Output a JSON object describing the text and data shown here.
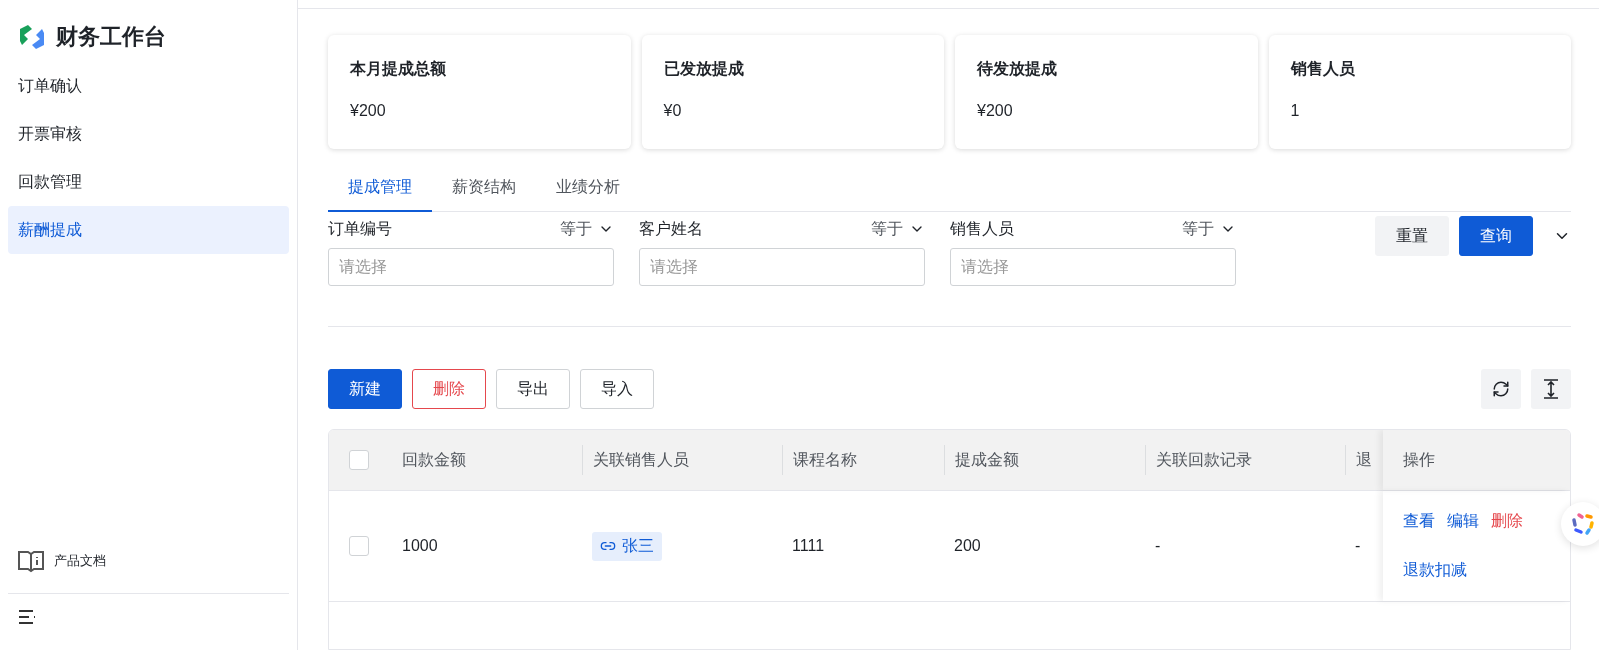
{
  "sidebar": {
    "title": "财务工作台",
    "items": [
      {
        "label": "订单确认",
        "selected": false
      },
      {
        "label": "开票审核",
        "selected": false
      },
      {
        "label": "回款管理",
        "selected": false
      },
      {
        "label": "薪酬提成",
        "selected": true
      }
    ],
    "footer_link": "产品文档"
  },
  "stats": [
    {
      "label": "本月提成总额",
      "value": "¥200"
    },
    {
      "label": "已发放提成",
      "value": "¥0"
    },
    {
      "label": "待发放提成",
      "value": "¥200"
    },
    {
      "label": "销售人员",
      "value": "1"
    }
  ],
  "tabs": [
    {
      "label": "提成管理",
      "selected": true
    },
    {
      "label": "薪资结构",
      "selected": false
    },
    {
      "label": "业绩分析",
      "selected": false
    }
  ],
  "filters": [
    {
      "label": "订单编号",
      "operator": "等于",
      "placeholder": "请选择"
    },
    {
      "label": "客户姓名",
      "operator": "等于",
      "placeholder": "请选择"
    },
    {
      "label": "销售人员",
      "operator": "等于",
      "placeholder": "请选择"
    }
  ],
  "filter_buttons": [
    {
      "label": "重置",
      "kind": "default"
    },
    {
      "label": "查询",
      "kind": "primary"
    }
  ],
  "toolbar": [
    {
      "label": "新建",
      "kind": "primary"
    },
    {
      "label": "删除",
      "kind": "danger"
    },
    {
      "label": "导出",
      "kind": "default"
    },
    {
      "label": "导入",
      "kind": "default"
    }
  ],
  "table": {
    "header_checked": false,
    "columns": [
      "回款金额",
      "关联销售人员",
      "课程名称",
      "提成金额",
      "关联回款记录",
      "退",
      "操作"
    ],
    "rows": [
      {
        "checked": false,
        "amount": "1000",
        "salesperson": "张三",
        "course": "1111",
        "commission": "200",
        "payment_record": "-",
        "column_6": "-",
        "actions": [
          {
            "label": "查看",
            "kind": "link"
          },
          {
            "label": "编辑",
            "kind": "link"
          },
          {
            "label": "删除",
            "kind": "danger"
          },
          {
            "label": "退款扣减",
            "kind": "link"
          }
        ]
      }
    ]
  }
}
